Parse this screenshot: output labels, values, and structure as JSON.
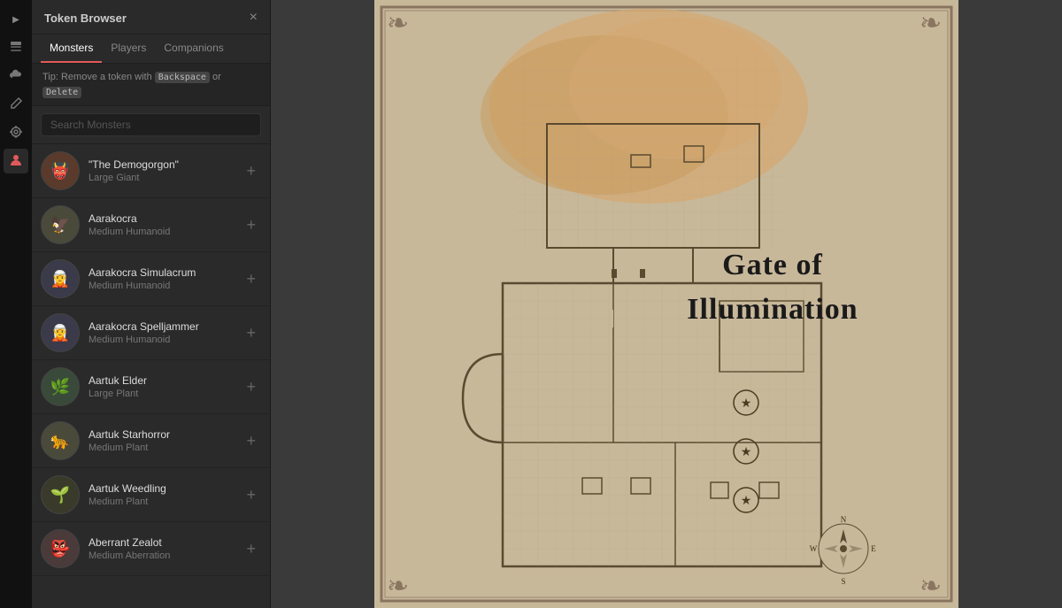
{
  "toolbar": {
    "expand_icon": "▶",
    "buttons": [
      {
        "name": "layers-icon",
        "icon": "⊞",
        "active": false
      },
      {
        "name": "cloud-icon",
        "icon": "☁",
        "active": false
      },
      {
        "name": "pencil-icon",
        "icon": "✏",
        "active": false
      },
      {
        "name": "target-icon",
        "icon": "◎",
        "active": false
      },
      {
        "name": "token-icon",
        "icon": "👤",
        "active": true
      }
    ]
  },
  "panel": {
    "title": "Token Browser",
    "close_label": "×",
    "tabs": [
      {
        "id": "monsters",
        "label": "Monsters",
        "active": true
      },
      {
        "id": "players",
        "label": "Players",
        "active": false
      },
      {
        "id": "companions",
        "label": "Companions",
        "active": false
      }
    ],
    "tip": {
      "prefix": "Tip: Remove a token with ",
      "key1": "Backspace",
      "middle": " or ",
      "key2": "Delete"
    },
    "search": {
      "placeholder": "Search Monsters",
      "value": ""
    },
    "monsters": [
      {
        "id": "demogorgon",
        "name": "\"The Demogorgon\"",
        "type": "Large Giant",
        "avatar_class": "av-demogorgon",
        "avatar_emoji": "👹"
      },
      {
        "id": "aarakocra",
        "name": "Aarakocra",
        "type": "Medium Humanoid",
        "avatar_class": "av-aarakocra",
        "avatar_emoji": "🦅"
      },
      {
        "id": "aarakocra-simulacrum",
        "name": "Aarakocra Simulacrum",
        "type": "Medium Humanoid",
        "avatar_class": "av-aarakocra-sim",
        "avatar_emoji": "🧝"
      },
      {
        "id": "aarakocra-spelljammer",
        "name": "Aarakocra Spelljammer",
        "type": "Medium Humanoid",
        "avatar_class": "av-aarakocra-spell",
        "avatar_emoji": "🧝"
      },
      {
        "id": "aartuk-elder",
        "name": "Aartuk Elder",
        "type": "Large Plant",
        "avatar_class": "av-aartuk-elder",
        "avatar_emoji": "🌿"
      },
      {
        "id": "aartuk-starhorror",
        "name": "Aartuk Starhorror",
        "type": "Medium Plant",
        "avatar_class": "av-aartuk-star",
        "avatar_emoji": "🐆"
      },
      {
        "id": "aartuk-weedling",
        "name": "Aartuk Weedling",
        "type": "Medium Plant",
        "avatar_class": "av-aartuk-weed",
        "avatar_emoji": "🌱"
      },
      {
        "id": "aberrant-zealot",
        "name": "Aberrant Zealot",
        "type": "Medium Aberration",
        "avatar_class": "av-aberrant",
        "avatar_emoji": "👺"
      }
    ],
    "add_button_label": "+"
  },
  "map": {
    "title": "Gate of Illumination",
    "background_color": "#c8b89a"
  }
}
